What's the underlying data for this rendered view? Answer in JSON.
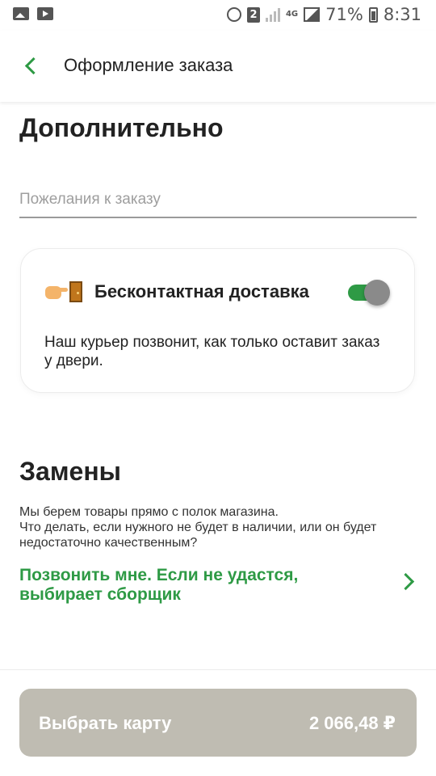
{
  "status_bar": {
    "network": "4G",
    "sim_slot": "2",
    "battery": "71%",
    "time": "8:31"
  },
  "header": {
    "title": "Оформление заказа"
  },
  "additional": {
    "title": "Дополнительно",
    "wishes_placeholder": "Пожелания к заказу",
    "contactless": {
      "title": "Бесконтактная доставка",
      "description": "Наш курьер позвонит, как только оставит заказ у двери.",
      "toggle_on": true
    }
  },
  "replacements": {
    "title": "Замены",
    "description": "Мы берем товары прямо с полок магазина.\nЧто делать, если нужного не будет в наличии, или он будет недостаточно качественным?",
    "option": "Позвонить мне. Если не удастся, выбирает сборщик"
  },
  "footer": {
    "pay_label": "Выбрать карту",
    "total": "2 066,48 ₽"
  },
  "colors": {
    "accent": "#2e9a45",
    "pay_button": "#bfbcb2"
  }
}
